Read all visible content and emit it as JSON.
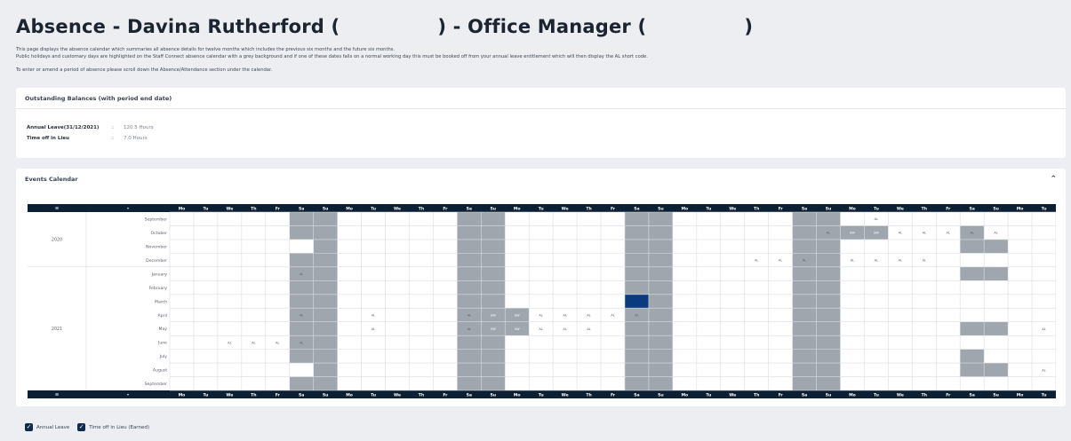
{
  "page": {
    "title_part1": "Absence - Davina Rutherford (",
    "title_part2": ") - Office Manager (",
    "title_part3": ")",
    "intro1": "This page displays the absence calendar which summaries all absence details for twelve months which includes the previous six months and the future six months.",
    "intro2": "Public holidays and customary days are highlighted on the Staff Connect absence calendar with a grey background and if one of these dates falls on a normal working day this must be booked off from your annual leave entitlement which will then display the AL short code.",
    "intro3": "To enter or amend a period of absence please scroll down the Absence/Attendance section under the calendar."
  },
  "balances": {
    "title": "Outstanding Balances (with period end date)",
    "rows": [
      {
        "label": "Annual Leave(31/12/2021)",
        "colon": ":",
        "value": "120.5 Hours"
      },
      {
        "label": "Time off in Lieu",
        "colon": ":",
        "value": "7.0 Hours"
      }
    ]
  },
  "calendar": {
    "title": "Events Calendar",
    "collapse_icon": "chevron-up-icon",
    "header_first": "≡",
    "header_second": "•",
    "day_headers": [
      "Mo",
      "Tu",
      "We",
      "Th",
      "Fr",
      "Sa",
      "Su",
      "Mo",
      "Tu",
      "We",
      "Th",
      "Fr",
      "Sa",
      "Su",
      "Mo",
      "Tu",
      "We",
      "Th",
      "Fr",
      "Sa",
      "Su",
      "Mo",
      "Tu",
      "We",
      "Th",
      "Fr",
      "Sa",
      "Su",
      "Mo",
      "Tu",
      "We",
      "Th",
      "Fr",
      "Sa",
      "Su",
      "Mo",
      "Tu"
    ],
    "years": [
      {
        "label": "2020",
        "rows": 4
      },
      {
        "label": "2021",
        "rows": 9
      }
    ],
    "months": [
      {
        "name": "September",
        "start": 1,
        "days": 30,
        "marks": {
          "29": "AL"
        }
      },
      {
        "name": "October",
        "start": 3,
        "days": 31,
        "marks": {
          "27": "AL",
          "28": "SW",
          "29": "SW",
          "30": "AL",
          "31": "AL",
          "32": "AL",
          "33": "AL",
          "34": "AL"
        }
      },
      {
        "name": "November",
        "start": 6,
        "days": 30,
        "marks": {}
      },
      {
        "name": "December",
        "start": 1,
        "days": 31,
        "marks": {
          "24": "AL",
          "25": "AL",
          "26": "AL",
          "28": "AL",
          "29": "AL",
          "30": "AL",
          "31": "AL"
        }
      },
      {
        "name": "January",
        "start": 4,
        "days": 31,
        "marks": {
          "5": "AL"
        }
      },
      {
        "name": "February",
        "start": 0,
        "days": 28,
        "marks": {}
      },
      {
        "name": "March",
        "start": 0,
        "days": 31,
        "marks": {
          "19": "TOIL"
        }
      },
      {
        "name": "April",
        "start": 3,
        "days": 30,
        "marks": {
          "5": "AL",
          "8": "AL",
          "12": "AL",
          "13": "SW",
          "14": "SW",
          "15": "AL",
          "16": "AL",
          "17": "AL",
          "18": "AL",
          "19": "AL"
        }
      },
      {
        "name": "May",
        "start": 5,
        "days": 31,
        "marks": {
          "8": "AL",
          "12": "AL",
          "13": "SW",
          "14": "SW",
          "15": "AL",
          "16": "AL",
          "17": "AL",
          "36": "AL"
        }
      },
      {
        "name": "June",
        "start": 1,
        "days": 30,
        "marks": {
          "2": "AL",
          "3": "AL",
          "4": "AL",
          "5": "AL"
        }
      },
      {
        "name": "July",
        "start": 3,
        "days": 31,
        "marks": {}
      },
      {
        "name": "August",
        "start": 6,
        "days": 31,
        "marks": {
          "36": "AL"
        }
      },
      {
        "name": "September",
        "start": 2,
        "days": 30,
        "marks": {}
      }
    ]
  },
  "legend": [
    {
      "label": "Annual Leave",
      "checked": true
    },
    {
      "label": "Time off in Lieu (Earned)",
      "checked": true
    }
  ],
  "colors": {
    "header_bg": "#0d1f33",
    "weekend": "#a0a6ad",
    "holiday": "#a0a6ad",
    "toil": "#0b3a7e",
    "grid": "#d9dde2"
  }
}
